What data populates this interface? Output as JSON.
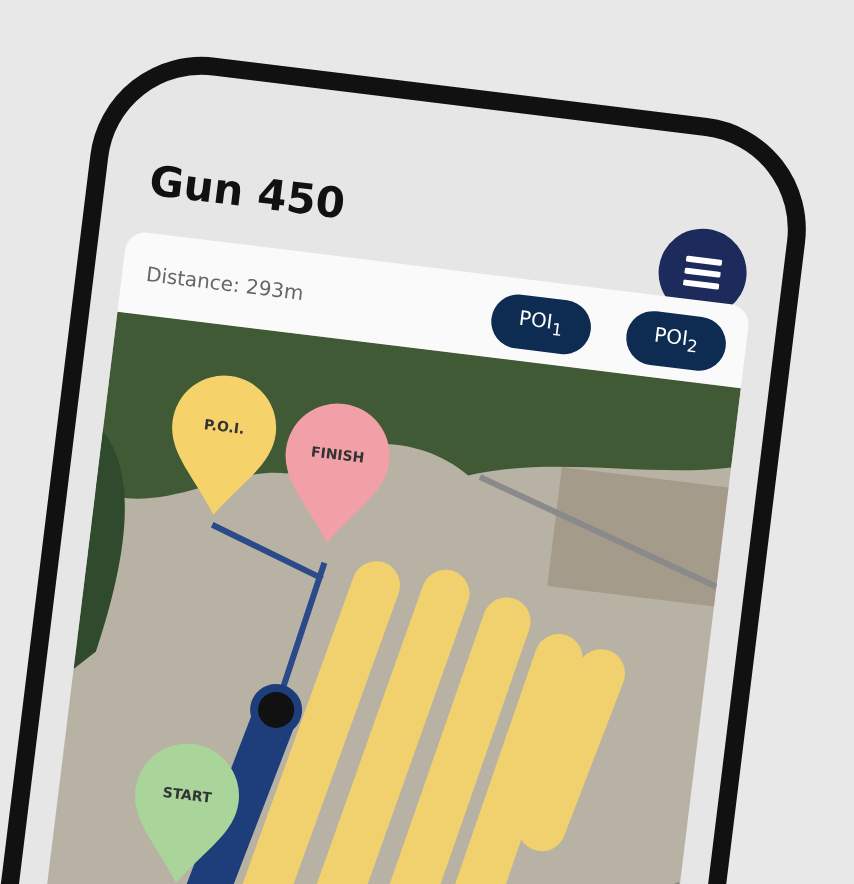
{
  "app": {
    "title": "Gun 450"
  },
  "info_bar": {
    "distance": "Distance: 293m",
    "poi_buttons": [
      "POI$_{1}$",
      "POI$_{2}$"
    ]
  },
  "map": {
    "pins": [
      {
        "label": "P.O.I.",
        "color": "#f6d36a"
      },
      {
        "label": "FINISH",
        "color": "#f2a0a8"
      },
      {
        "label": "START",
        "color": "#a9d49a"
      }
    ]
  }
}
